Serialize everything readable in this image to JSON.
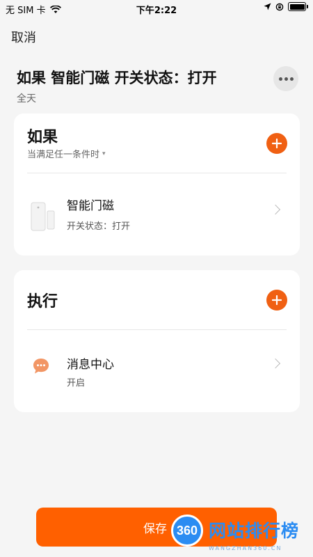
{
  "status_bar": {
    "carrier": "无 SIM 卡",
    "time": "下午2:22"
  },
  "header": {
    "cancel_label": "取消",
    "title": "如果 智能门磁 开关状态：打开",
    "subtitle": "全天"
  },
  "condition_card": {
    "title": "如果",
    "mode_label": "当满足任一条件时",
    "items": [
      {
        "name": "智能门磁",
        "detail": "开关状态：打开",
        "icon": "door-sensor-icon"
      }
    ]
  },
  "action_card": {
    "title": "执行",
    "items": [
      {
        "name": "消息中心",
        "detail": "开启",
        "icon": "message-icon"
      }
    ]
  },
  "footer": {
    "save_label": "保存"
  },
  "watermark": {
    "badge": "360",
    "text": "网站排行榜",
    "subtext": "WANGZHAN360.CN"
  },
  "colors": {
    "accent": "#f06013",
    "save_button": "#ff6000",
    "background": "#f5f5f5",
    "watermark": "#2b8cf2"
  }
}
